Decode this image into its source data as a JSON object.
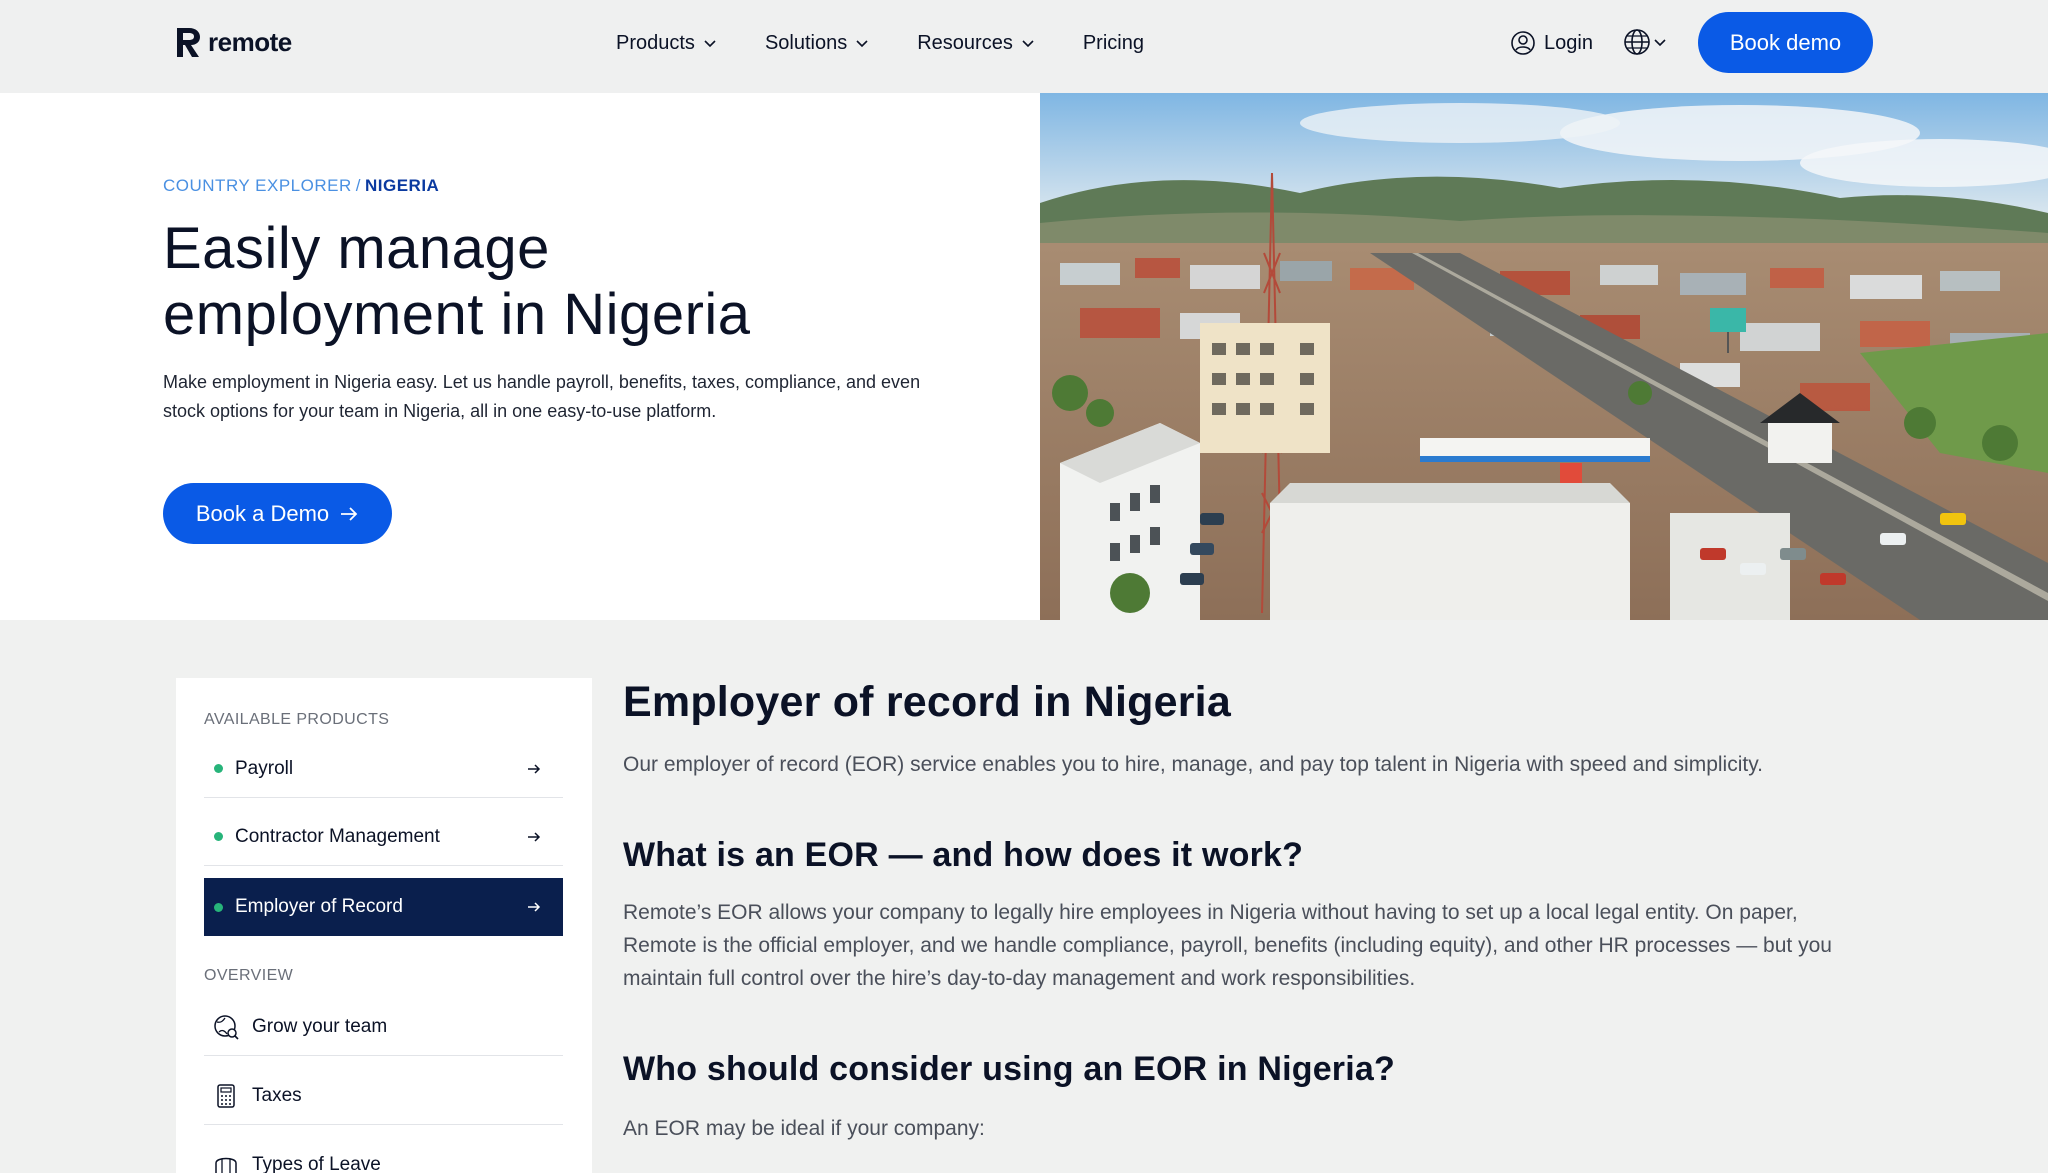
{
  "nav": {
    "logo_text": "remote",
    "menu": [
      {
        "label": "Products",
        "has_dropdown": true
      },
      {
        "label": "Solutions",
        "has_dropdown": true
      },
      {
        "label": "Resources",
        "has_dropdown": true
      },
      {
        "label": "Pricing",
        "has_dropdown": false
      }
    ],
    "login_label": "Login",
    "language_icon": "globe-icon",
    "book_demo_label": "Book demo"
  },
  "hero": {
    "breadcrumb": {
      "parent": "COUNTRY EXPLORER",
      "separator": "/",
      "current": "NIGERIA"
    },
    "title_line1": "Easily manage",
    "title_line2": "employment in Nigeria",
    "description": "Make employment in Nigeria easy. Let us handle payroll, benefits, taxes, compliance, and even stock options for your team in Nigeria, all in one easy-to-use platform.",
    "cta_label": "Book a Demo"
  },
  "sidebar": {
    "products_label": "AVAILABLE PRODUCTS",
    "products": [
      {
        "label": "Payroll",
        "active": false
      },
      {
        "label": "Contractor Management",
        "active": false
      },
      {
        "label": "Employer of Record",
        "active": true
      }
    ],
    "overview_label": "OVERVIEW",
    "overview": [
      {
        "label": "Grow your team",
        "icon": "globe-search-icon"
      },
      {
        "label": "Taxes",
        "icon": "calculator-icon"
      },
      {
        "label": "Types of Leave",
        "icon": "briefcase-icon"
      }
    ]
  },
  "main": {
    "heading": "Employer of record in Nigeria",
    "intro": "Our employer of record (EOR) service enables you to hire, manage, and pay top talent in Nigeria with speed and simplicity.",
    "section1_heading": "What is an EOR — and how does it work?",
    "section1_body": "Remote’s EOR allows your company to legally hire employees in Nigeria without having to set up a local legal entity. On paper, Remote is the official employer, and we handle compliance, payroll, benefits (including equity), and other HR processes — but you maintain full control over the hire’s day-to-day management and work responsibilities.",
    "section2_heading": "Who should consider using an EOR in Nigeria?",
    "section2_body": "An EOR may be ideal if your company:"
  },
  "colors": {
    "accent": "#0a5ae6",
    "active_nav": "#0a1f4d",
    "dot": "#27b47a"
  }
}
